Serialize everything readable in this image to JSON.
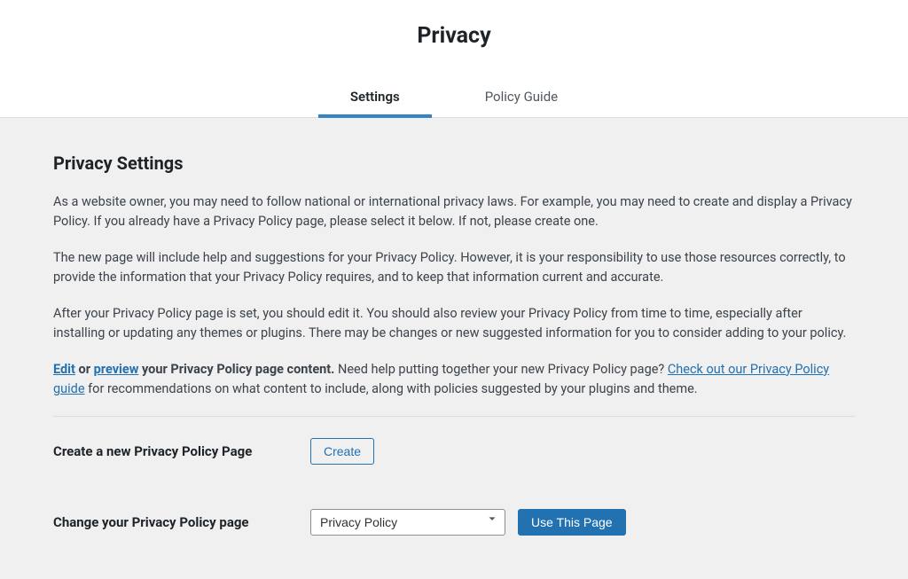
{
  "header": {
    "title": "Privacy"
  },
  "tabs": {
    "settings": "Settings",
    "guide": "Policy Guide"
  },
  "section": {
    "title": "Privacy Settings",
    "para1": "As a website owner, you may need to follow national or international privacy laws. For example, you may need to create and display a Privacy Policy. If you already have a Privacy Policy page, please select it below. If not, please create one.",
    "para2": "The new page will include help and suggestions for your Privacy Policy. However, it is your responsibility to use those resources correctly, to provide the information that your Privacy Policy requires, and to keep that information current and accurate.",
    "para3": "After your Privacy Policy page is set, you should edit it. You should also review your Privacy Policy from time to time, especially after installing or updating any themes or plugins. There may be changes or new suggested information for you to consider adding to your policy.",
    "para4": {
      "edit_link": "Edit",
      "or_text": " or ",
      "preview_link": "preview",
      "bold_rest": " your Privacy Policy page content.",
      "help_text": " Need help putting together your new Privacy Policy page? ",
      "guide_link": "Check out our Privacy Policy guide",
      "rest": " for recommendations on what content to include, along with policies suggested by your plugins and theme."
    }
  },
  "form": {
    "create_label": "Create a new Privacy Policy Page",
    "create_button": "Create",
    "change_label": "Change your Privacy Policy page",
    "select_value": "Privacy Policy",
    "use_button": "Use This Page"
  }
}
